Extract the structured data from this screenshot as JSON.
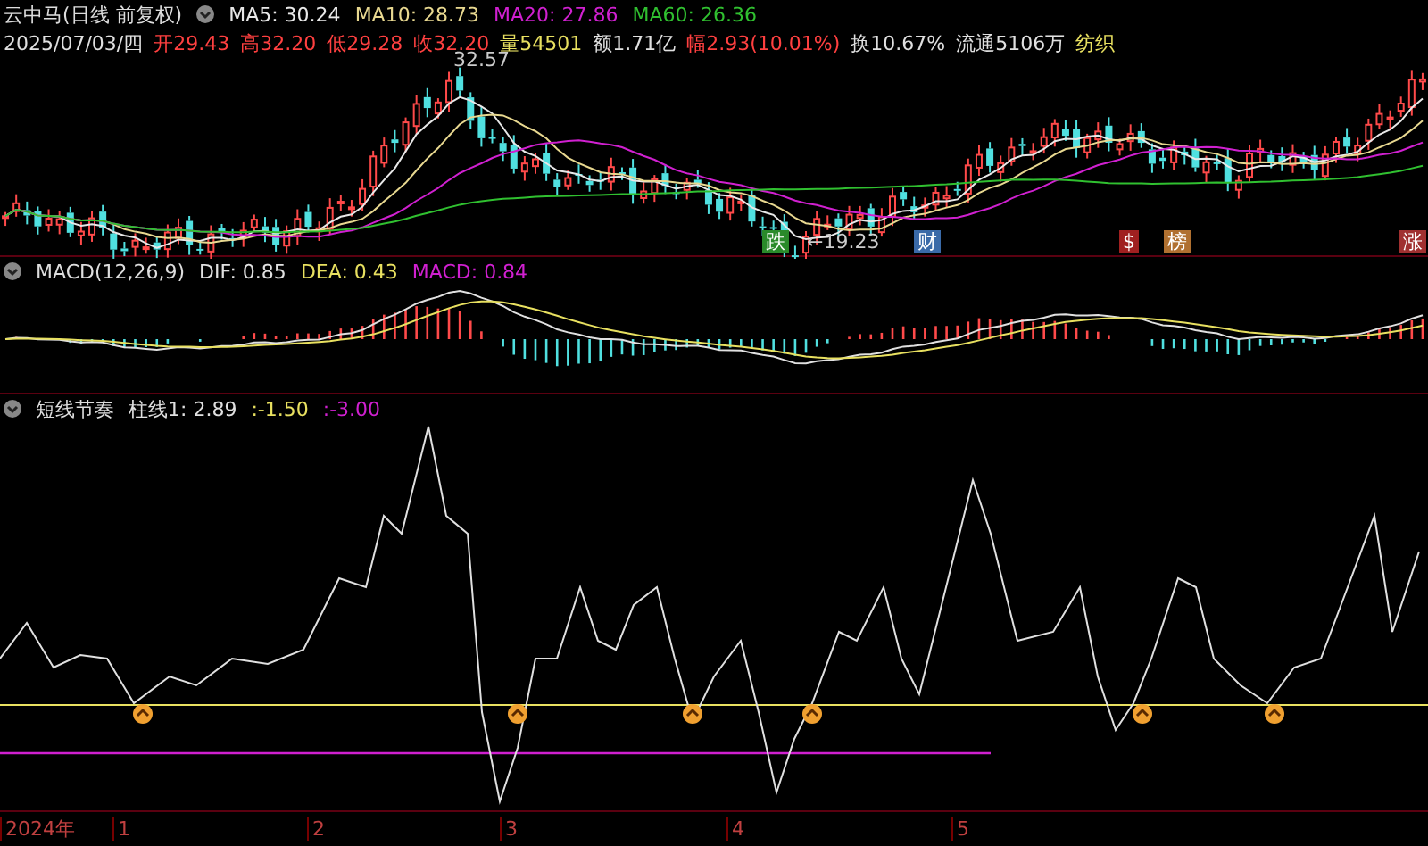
{
  "price_panel": {
    "title": "云中马(日线 前复权)",
    "ma_legend": [
      {
        "label": "MA5: 30.24",
        "color": "#e8e8e8"
      },
      {
        "label": "MA10: 28.73",
        "color": "#e8d890"
      },
      {
        "label": "MA20: 27.86",
        "color": "#d020d0"
      },
      {
        "label": "MA60: 26.36",
        "color": "#30c030"
      }
    ],
    "quote": [
      {
        "text": "2025/07/03/四",
        "color": "#e0e0e0"
      },
      {
        "text": "开29.43",
        "color": "#ff4040"
      },
      {
        "text": "高32.20",
        "color": "#ff4040"
      },
      {
        "text": "低29.28",
        "color": "#ff4040"
      },
      {
        "text": "收32.20",
        "color": "#ff4040"
      },
      {
        "text": "量54501",
        "color": "#e8e060"
      },
      {
        "text": "额1.71亿",
        "color": "#e0e0e0"
      },
      {
        "text": "幅2.93(10.01%)",
        "color": "#ff4040"
      },
      {
        "text": "换10.67%",
        "color": "#e0e0e0"
      },
      {
        "text": "流通5106万",
        "color": "#e0e0e0"
      },
      {
        "text": "纺织",
        "color": "#e8e060"
      }
    ],
    "high_label": "32.57",
    "low_label": "←19.23",
    "event_markers": [
      {
        "text": "跌",
        "color": "#2a8a2a"
      },
      {
        "text": "财",
        "color": "#3a6aa8"
      },
      {
        "text": "$",
        "color": "#a02020"
      },
      {
        "text": "榜",
        "color": "#b07030"
      },
      {
        "text": "涨",
        "color": "#a03030"
      }
    ]
  },
  "macd_panel": {
    "title": "MACD(12,26,9)",
    "values": [
      {
        "label": "DIF: 0.85",
        "color": "#e0e0e0"
      },
      {
        "label": "DEA: 0.43",
        "color": "#e8e060"
      },
      {
        "label": "MACD: 0.84",
        "color": "#d020d0"
      }
    ]
  },
  "rhythm_panel": {
    "title": "短线节奏",
    "values": [
      {
        "label": "柱线1: 2.89",
        "color": "#e0e0e0"
      },
      {
        "label": ":-1.50",
        "color": "#e8e060"
      },
      {
        "label": ":-3.00",
        "color": "#d020d0"
      }
    ]
  },
  "time_axis": {
    "labels": [
      "2024年",
      "1",
      "2",
      "3",
      "4",
      "5"
    ]
  }
}
